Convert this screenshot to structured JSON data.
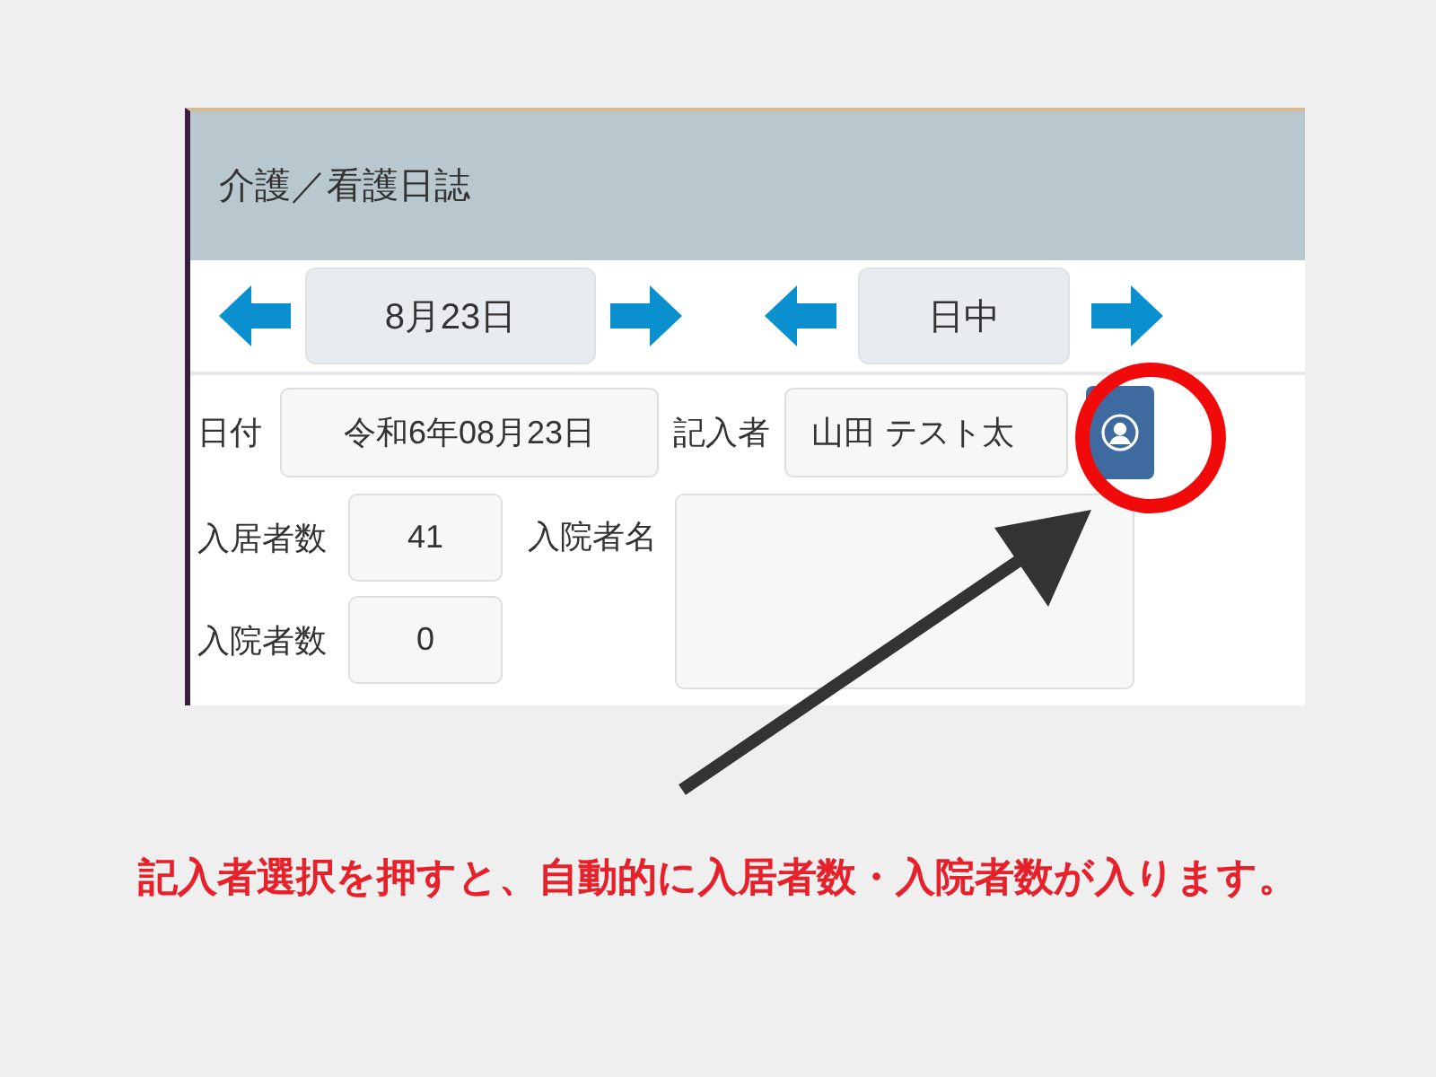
{
  "app": {
    "title": "介護／看護日誌"
  },
  "date_nav": {
    "value": "8月23日"
  },
  "shift_nav": {
    "value": "日中"
  },
  "form": {
    "date_label": "日付",
    "date_value": "令和6年08月23日",
    "writer_label": "記入者",
    "writer_value": "山田 テスト太",
    "residents_label": "入居者数",
    "residents_value": "41",
    "hospitalized_names_label": "入院者名",
    "hospitalized_count_label": "入院者数",
    "hospitalized_count_value": "0"
  },
  "annotation": {
    "caption": "記入者選択を押すと、自動的に入居者数・入院者数が入ります。"
  }
}
